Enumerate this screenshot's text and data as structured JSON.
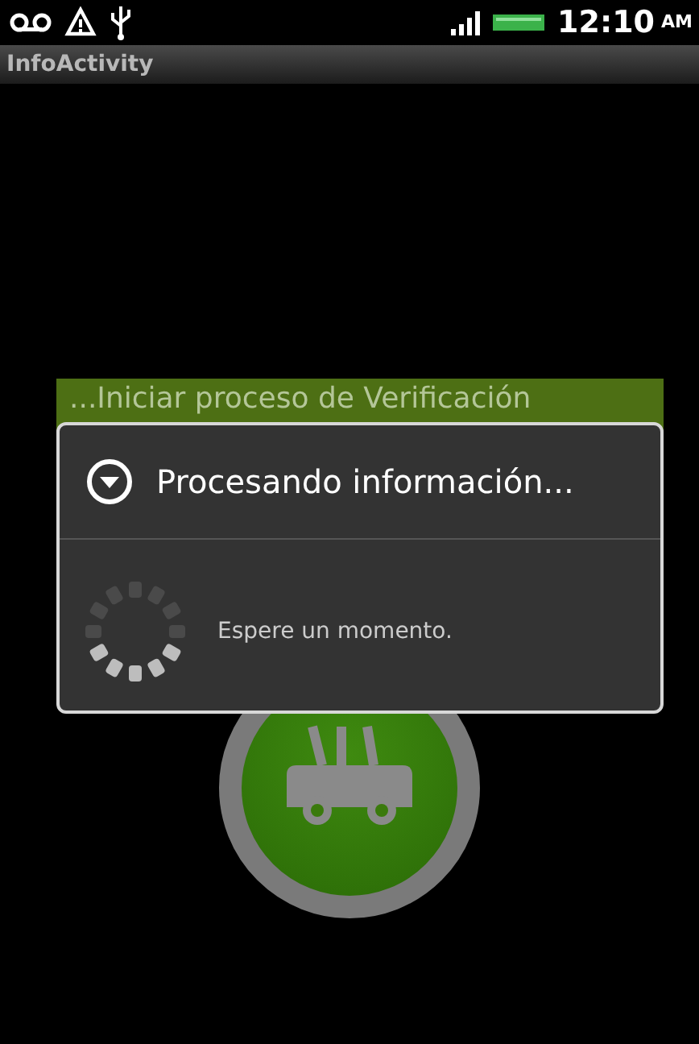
{
  "status_bar": {
    "time": "12:10",
    "meridiem": "AM"
  },
  "title_bar": {
    "title": "InfoActivity"
  },
  "banner": {
    "text": "...Iniciar proceso de Verificación"
  },
  "dialog": {
    "title": "Procesando información...",
    "message": "Espere un momento."
  }
}
